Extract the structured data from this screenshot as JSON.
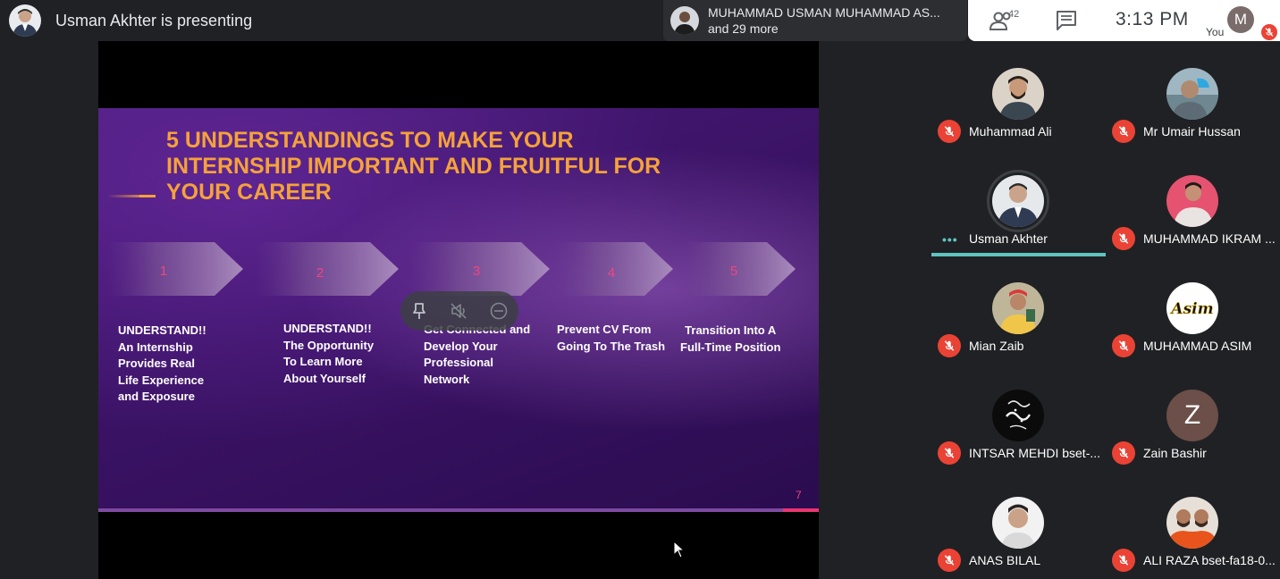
{
  "topbar": {
    "presenting_text": "Usman Akhter is presenting",
    "joined_name": "MUHAMMAD USMAN MUHAMMAD AS...",
    "joined_more": "and 29 more",
    "participant_count": "42",
    "time": "3:13 PM",
    "self_initial": "M",
    "self_label": "You"
  },
  "slide": {
    "title_lines": [
      "5 UNDERSTANDINGS TO MAKE YOUR",
      "INTERNSHIP IMPORTANT AND FRUITFUL FOR",
      "YOUR CAREER"
    ],
    "steps": [
      {
        "num": "1",
        "lines": [
          "UNDERSTAND!!",
          "An Internship",
          "Provides Real",
          "Life Experience",
          "and Exposure"
        ]
      },
      {
        "num": "2",
        "lines": [
          "UNDERSTAND!!",
          "The Opportunity",
          "To Learn More",
          "About Yourself"
        ]
      },
      {
        "num": "3",
        "lines": [
          "Get Connected and",
          "Develop Your",
          "Professional",
          "Network"
        ]
      },
      {
        "num": "4",
        "lines": [
          "Prevent CV From",
          "Going To The Trash"
        ]
      },
      {
        "num": "5",
        "lines": [
          "Transition Into A",
          "Full-Time Position"
        ]
      }
    ],
    "page_number": "7"
  },
  "participants": [
    {
      "name": "Muhammad Ali",
      "avatar": "photo"
    },
    {
      "name": "Mr Umair Hussan",
      "avatar": "photo"
    },
    {
      "name": "Usman Akhter",
      "avatar": "photo",
      "speaking": true
    },
    {
      "name": "MUHAMMAD IKRAM ...",
      "avatar": "photo"
    },
    {
      "name": "Mian Zaib",
      "avatar": "photo"
    },
    {
      "name": "MUHAMMAD ASIM",
      "avatar": "logo",
      "logo_text": "Asim"
    },
    {
      "name": "INTSAR MEHDI bset-...",
      "avatar": "calligraphy"
    },
    {
      "name": "Zain Bashir",
      "avatar": "letter",
      "letter": "Z"
    },
    {
      "name": "ANAS BILAL",
      "avatar": "photo"
    },
    {
      "name": "ALI RAZA bset-fa18-0...",
      "avatar": "photo"
    }
  ],
  "colors": {
    "background": "#202124",
    "slide_title": "#f5a23a",
    "slide_accent": "#f04580",
    "muted_red": "#ea4335",
    "speaking_teal": "#5ec4c0"
  },
  "icons": [
    "people-icon",
    "chat-icon",
    "mic-off-icon",
    "pin-icon",
    "mute-icon",
    "remove-icon",
    "cursor-icon"
  ]
}
